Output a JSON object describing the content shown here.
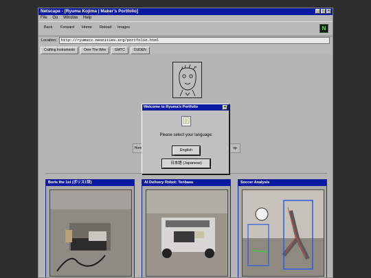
{
  "window": {
    "title": "Netscape - [Ryuma Kojima | Maker's Portfolio]",
    "controls": [
      "_",
      "□",
      "×"
    ]
  },
  "menu": [
    "File",
    "Go",
    "Window",
    "Help"
  ],
  "toolbar": {
    "back": "Back",
    "forward": "Forward",
    "home": "Home",
    "reload": "Reload",
    "images": "Images"
  },
  "location": {
    "label": "Location:",
    "url": "http://ryumacx.neocities.org/portfolio.html"
  },
  "bookmarks": [
    "Crafting Instruments",
    "Over The Wire",
    "GMTC",
    "DUDEN"
  ],
  "page": {
    "left_button": "Hom",
    "right_button": "op",
    "cards": [
      {
        "title": "Boris the 1st (ボリス1世)"
      },
      {
        "title": "AI Delivery Robot: Tenbasu"
      },
      {
        "title": "Soccer Analysis"
      }
    ]
  },
  "dialog": {
    "title": "Welcome to Ryuma's Portfolio",
    "close": "×",
    "prompt": "Please select your language:",
    "english": "English",
    "japanese": "日本語 (Japanese)"
  },
  "colors": {
    "titlebar": "#0a1aa0",
    "chrome": "#c0c0c0",
    "desktop": "#2e2e2e"
  }
}
